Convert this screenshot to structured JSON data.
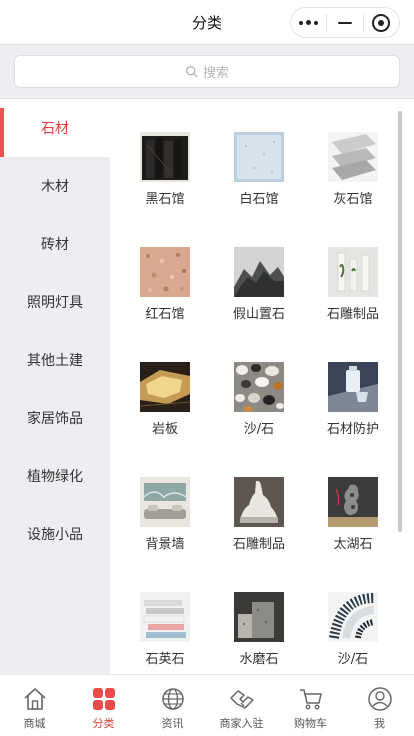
{
  "nav": {
    "title": "分类"
  },
  "search": {
    "placeholder": "搜索"
  },
  "sidebar": {
    "items": [
      {
        "label": "石材",
        "active": true
      },
      {
        "label": "木材"
      },
      {
        "label": "砖材"
      },
      {
        "label": "照明灯具"
      },
      {
        "label": "其他土建"
      },
      {
        "label": "家居饰品"
      },
      {
        "label": "植物绿化"
      },
      {
        "label": "设施小品"
      }
    ]
  },
  "products": [
    {
      "label": "黑石馆",
      "icon": "black-stone-thumb"
    },
    {
      "label": "白石馆",
      "icon": "white-stone-thumb"
    },
    {
      "label": "灰石馆",
      "icon": "gray-stone-thumb"
    },
    {
      "label": "红石馆",
      "icon": "red-stone-thumb"
    },
    {
      "label": "假山置石",
      "icon": "rockery-thumb"
    },
    {
      "label": "石雕制品",
      "icon": "stone-carving-thumb"
    },
    {
      "label": "岩板",
      "icon": "slab-thumb"
    },
    {
      "label": "沙/石",
      "icon": "pebbles-thumb"
    },
    {
      "label": "石材防护",
      "icon": "stone-protection-thumb"
    },
    {
      "label": "背景墙",
      "icon": "background-wall-thumb"
    },
    {
      "label": "石雕制品",
      "icon": "stone-statue-thumb"
    },
    {
      "label": "太湖石",
      "icon": "taihu-stone-thumb"
    },
    {
      "label": "石英石",
      "icon": "quartz-stone-thumb"
    },
    {
      "label": "水磨石",
      "icon": "terrazzo-thumb"
    },
    {
      "label": "沙/石",
      "icon": "gravel-thumb"
    }
  ],
  "tabbar": {
    "items": [
      {
        "label": "商城",
        "icon": "home-icon"
      },
      {
        "label": "分类",
        "icon": "category-icon",
        "active": true
      },
      {
        "label": "资讯",
        "icon": "globe-icon"
      },
      {
        "label": "商家入驻",
        "icon": "handshake-icon"
      },
      {
        "label": "购物车",
        "icon": "cart-icon"
      },
      {
        "label": "我",
        "icon": "user-icon"
      }
    ]
  },
  "colors": {
    "accent": "#e63c3c",
    "sidebar_bg": "#eeeef2"
  }
}
